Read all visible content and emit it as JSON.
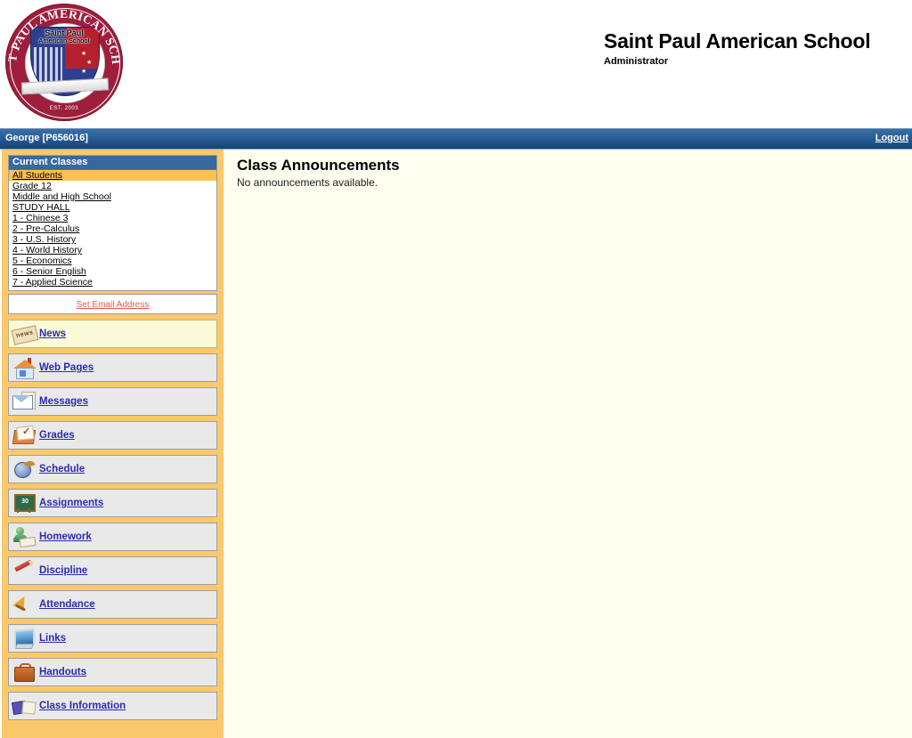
{
  "header": {
    "logo": {
      "arc_text": "SAINT PAUL AMERICAN SCHOOL",
      "seal_name": "Saint Paul",
      "seal_sub": "American School",
      "established": "EST. 2003"
    },
    "title": "Saint Paul American School",
    "subtitle": "Administrator"
  },
  "userbar": {
    "user": "George  [P656016]",
    "logout_label": "Logout"
  },
  "sidebar": {
    "classes_header": "Current Classes",
    "classes": [
      {
        "label": "All Students",
        "active": true
      },
      {
        "label": "Grade 12",
        "active": false
      },
      {
        "label": "Middle and High School",
        "active": false
      },
      {
        "label": "STUDY HALL",
        "active": false
      },
      {
        "label": "1 - Chinese 3",
        "active": false
      },
      {
        "label": "2 - Pre-Calculus",
        "active": false
      },
      {
        "label": "3 - U.S. History",
        "active": false
      },
      {
        "label": "4 - World History",
        "active": false
      },
      {
        "label": "5 - Economics",
        "active": false
      },
      {
        "label": "6 - Senior English",
        "active": false
      },
      {
        "label": "7 - Applied Science",
        "active": false
      }
    ],
    "set_email_label": "Set Email Address",
    "nav": [
      {
        "label": "News",
        "icon": "news-icon",
        "current": true
      },
      {
        "label": "Web Pages",
        "icon": "house-icon",
        "current": false
      },
      {
        "label": "Messages",
        "icon": "envelope-icon",
        "current": false
      },
      {
        "label": "Grades",
        "icon": "gradebook-icon",
        "current": false
      },
      {
        "label": "Schedule",
        "icon": "globe-wing-icon",
        "current": false
      },
      {
        "label": "Assignments",
        "icon": "chalkboard-icon",
        "current": false
      },
      {
        "label": "Homework",
        "icon": "student-book-icon",
        "current": false
      },
      {
        "label": "Discipline",
        "icon": "pencil-icon",
        "current": false
      },
      {
        "label": "Attendance",
        "icon": "bell-icon",
        "current": false
      },
      {
        "label": "Links",
        "icon": "monitor-icon",
        "current": false
      },
      {
        "label": "Handouts",
        "icon": "briefcase-icon",
        "current": false
      },
      {
        "label": "Class Information",
        "icon": "open-book-icon",
        "current": false
      }
    ]
  },
  "main": {
    "title": "Class Announcements",
    "body": "No announcements available."
  },
  "colors": {
    "userbar_blue": "#2f639d",
    "sidebar_frame": "#fbc96b",
    "class_header_blue": "#36699e",
    "active_class_orange": "#ffc14d",
    "link_blue": "#2b2bb0",
    "email_link_red": "#e05a5a",
    "content_bg": "#fffff0",
    "seal_maroon": "#9d1f3c"
  }
}
